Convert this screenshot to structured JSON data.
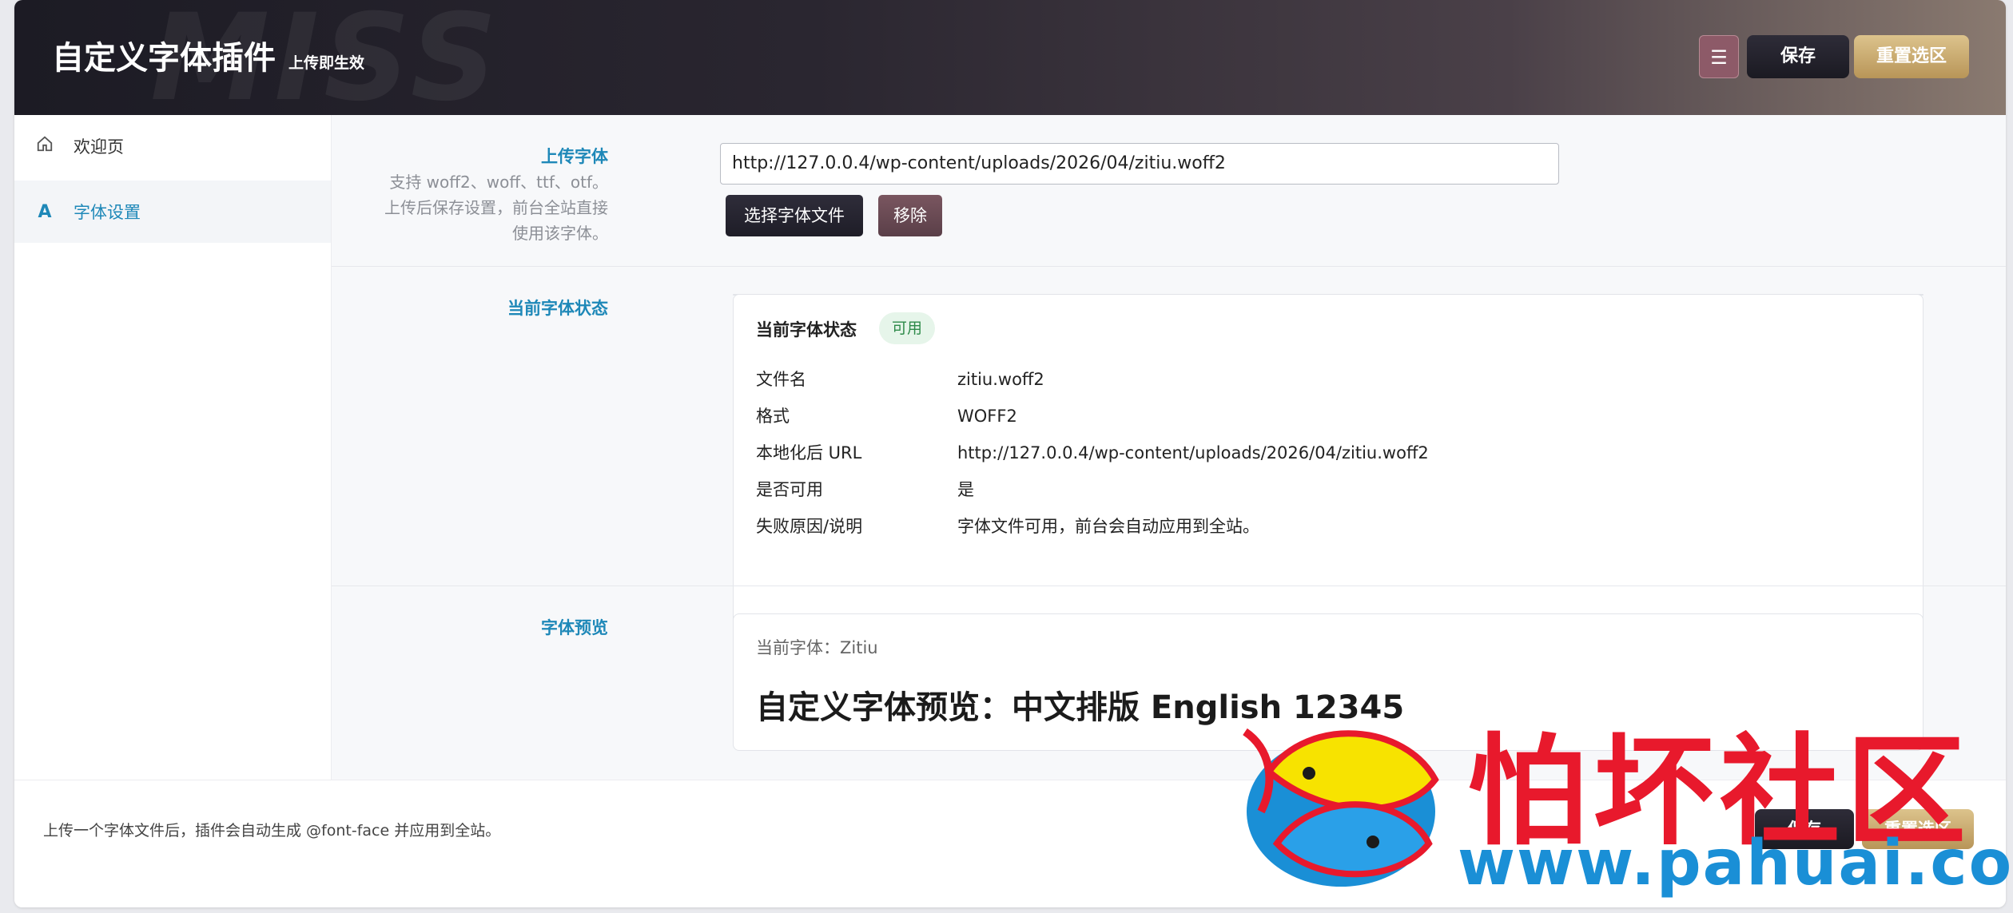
{
  "header": {
    "watermark": "MISS",
    "title": "自定义字体插件",
    "subtitle": "上传即生效",
    "menu_icon": "☰",
    "save_label": "保存",
    "reset_label": "重置选区"
  },
  "sidebar": {
    "items": [
      {
        "label": "欢迎页",
        "icon": "home-icon"
      },
      {
        "label": "字体设置",
        "icon": "font-icon",
        "glyph": "A"
      }
    ]
  },
  "upload": {
    "label": "上传字体",
    "description": "支持 woff2、woff、ttf、otf。上传后保存设置，前台全站直接使用该字体。",
    "url_value": "http://127.0.0.4/wp-content/uploads/2026/04/zitiu.woff2",
    "choose_label": "选择字体文件",
    "remove_label": "移除"
  },
  "status": {
    "label": "当前字体状态",
    "card_title": "当前字体状态",
    "badge": "可用",
    "badge_color": "#2d8a49",
    "rows": [
      {
        "key": "文件名",
        "value": "zitiu.woff2"
      },
      {
        "key": "格式",
        "value": "WOFF2"
      },
      {
        "key": "本地化后 URL",
        "value": "http://127.0.0.4/wp-content/uploads/2026/04/zitiu.woff2"
      },
      {
        "key": "是否可用",
        "value": "是"
      },
      {
        "key": "失败原因/说明",
        "value": "字体文件可用，前台会自动应用到全站。"
      }
    ]
  },
  "preview": {
    "label": "字体预览",
    "current_font": "当前字体：Zitiu",
    "sample": "自定义字体预览：中文排版 English 12345"
  },
  "footer": {
    "note": "上传一个字体文件后，插件会自动生成 @font-face 并应用到全站。",
    "save_label": "保存",
    "reset_label": "重置选区"
  },
  "overlay": {
    "brand_cn": "怕坏社区",
    "brand_url": "www.pahuai.com"
  },
  "colors": {
    "accent": "#1e88b8",
    "brand_red": "#e8192c",
    "brand_blue": "#1a8fd6",
    "gold": "#c9a76a"
  }
}
